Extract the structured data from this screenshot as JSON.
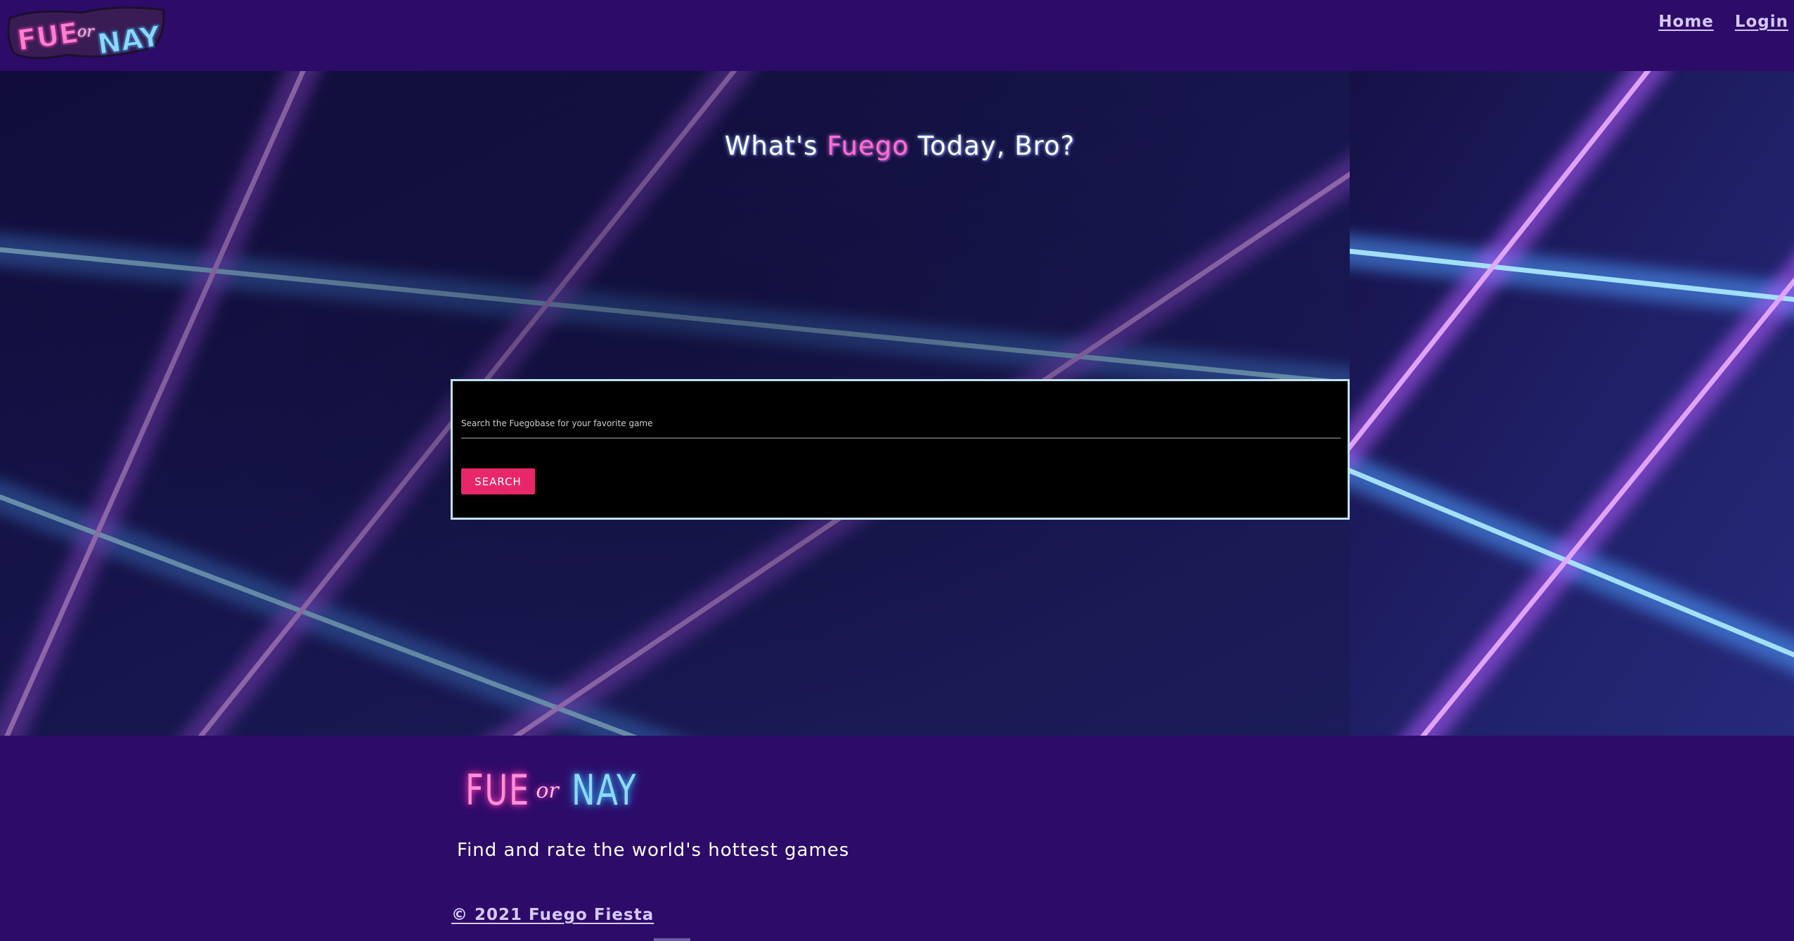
{
  "navbar": {
    "logo": {
      "fue": "FUE",
      "or": "or",
      "nay": "NAY"
    },
    "links": {
      "home": "Home",
      "login": "Login"
    }
  },
  "hero": {
    "title_prefix": "What's ",
    "title_accent": "Fuego",
    "title_suffix": " Today, Bro?"
  },
  "search": {
    "placeholder": "Search the Fuegobase for your favorite game",
    "value": "",
    "button_label": "SEARCH"
  },
  "footer": {
    "logo": {
      "fue": "FUE",
      "or": "or",
      "nay": "NAY"
    },
    "tagline": "Find and rate the world's hottest games",
    "copyright": "© 2021 Fuego Fiesta"
  },
  "colors": {
    "nav_background": "#2d0b69",
    "nav_link": "#d7c8ff",
    "title_accent": "#ff6fd3",
    "search_button": "#e8276b",
    "card_border": "#bfe3ee",
    "laser_pink": "#d27cff",
    "laser_blue": "#4fb6ff"
  }
}
